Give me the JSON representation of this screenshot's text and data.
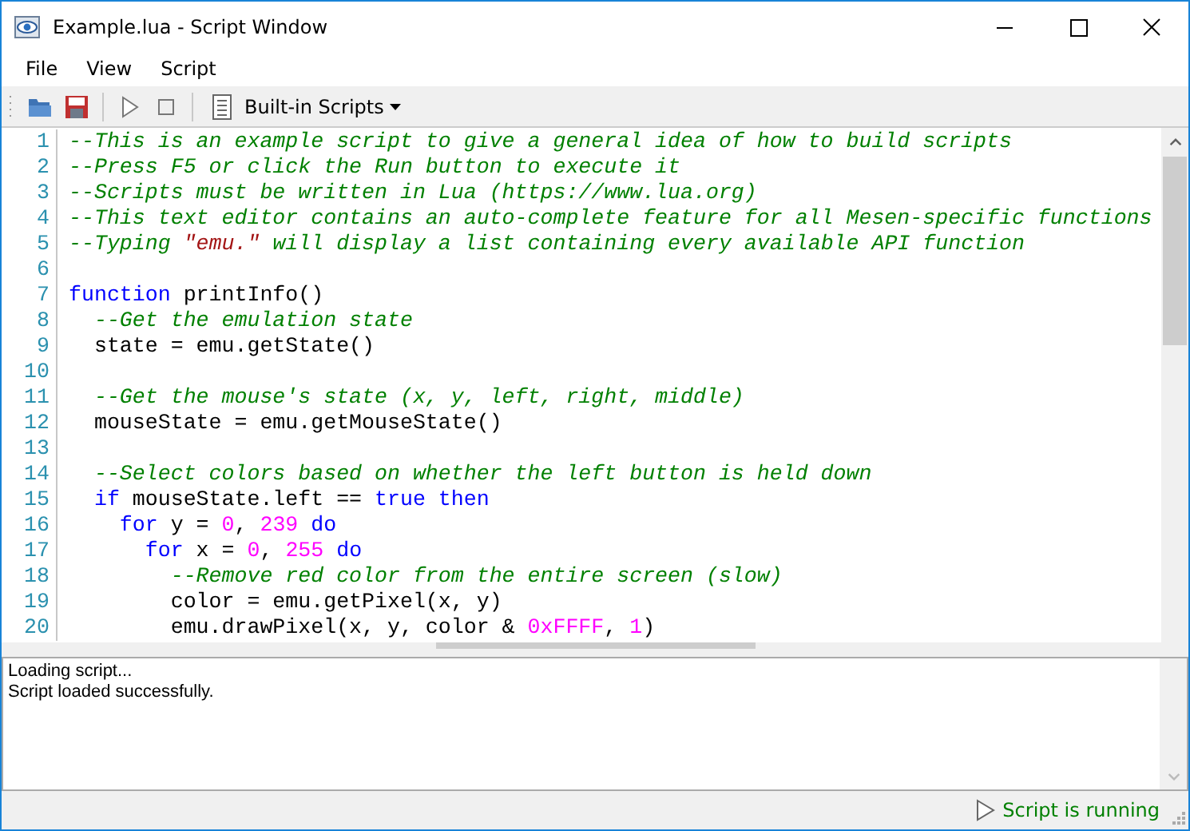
{
  "window": {
    "title": "Example.lua - Script Window"
  },
  "menu": [
    "File",
    "View",
    "Script"
  ],
  "toolbar": {
    "dropdown": "Built-in Scripts"
  },
  "editor": {
    "lines": [
      {
        "number": "1",
        "tokens": [
          {
            "kind": "comment",
            "text": "--This is an example script to give a general idea of how to build scripts"
          }
        ]
      },
      {
        "number": "2",
        "tokens": [
          {
            "kind": "comment",
            "text": "--Press F5 or click the Run button to execute it"
          }
        ]
      },
      {
        "number": "3",
        "tokens": [
          {
            "kind": "comment",
            "text": "--Scripts must be written in Lua (https://www.lua.org)"
          }
        ]
      },
      {
        "number": "4",
        "tokens": [
          {
            "kind": "comment",
            "text": "--This text editor contains an auto-complete feature for all Mesen-specific functions"
          }
        ]
      },
      {
        "number": "5",
        "tokens": [
          {
            "kind": "comment",
            "text": "--Typing "
          },
          {
            "kind": "string",
            "text": "\"emu.\""
          },
          {
            "kind": "comment",
            "text": " will display a list containing every available API function"
          }
        ]
      },
      {
        "number": "6"
      },
      {
        "number": "7",
        "tokens": [
          {
            "kind": "keyword",
            "text": "function"
          },
          {
            "kind": "plain",
            "text": " printInfo()"
          }
        ]
      },
      {
        "number": "8",
        "tokens": [
          {
            "kind": "comment",
            "text": "  --Get the emulation state"
          }
        ]
      },
      {
        "number": "9",
        "tokens": [
          {
            "kind": "plain",
            "text": "  state = emu.getState()"
          }
        ]
      },
      {
        "number": "10"
      },
      {
        "number": "11",
        "tokens": [
          {
            "kind": "comment",
            "text": "  --Get the mouse's state (x, y, left, right, middle)"
          }
        ]
      },
      {
        "number": "12",
        "tokens": [
          {
            "kind": "plain",
            "text": "  mouseState = emu.getMouseState()"
          }
        ]
      },
      {
        "number": "13"
      },
      {
        "number": "14",
        "tokens": [
          {
            "kind": "comment",
            "text": "  --Select colors based on whether the left button is held down"
          }
        ]
      },
      {
        "number": "15",
        "tokens": [
          {
            "kind": "keyword",
            "text": "  if"
          },
          {
            "kind": "plain",
            "text": " mouseState.left == "
          },
          {
            "kind": "keyword",
            "text": "true then"
          }
        ]
      },
      {
        "number": "16",
        "tokens": [
          {
            "kind": "keyword",
            "text": "    for"
          },
          {
            "kind": "plain",
            "text": " y = "
          },
          {
            "kind": "number",
            "text": "0"
          },
          {
            "kind": "plain",
            "text": ", "
          },
          {
            "kind": "number",
            "text": "239"
          },
          {
            "kind": "keyword",
            "text": " do"
          }
        ]
      },
      {
        "number": "17",
        "tokens": [
          {
            "kind": "keyword",
            "text": "      for"
          },
          {
            "kind": "plain",
            "text": " x = "
          },
          {
            "kind": "number",
            "text": "0"
          },
          {
            "kind": "plain",
            "text": ", "
          },
          {
            "kind": "number",
            "text": "255"
          },
          {
            "kind": "keyword",
            "text": " do"
          }
        ]
      },
      {
        "number": "18",
        "tokens": [
          {
            "kind": "comment",
            "text": "        --Remove red color from the entire screen (slow)"
          }
        ]
      },
      {
        "number": "19",
        "tokens": [
          {
            "kind": "plain",
            "text": "        color = emu.getPixel(x, y)"
          }
        ]
      },
      {
        "number": "20",
        "tokens": [
          {
            "kind": "plain",
            "text": "        emu.drawPixel(x, y, color & "
          },
          {
            "kind": "number",
            "text": "0xFFFF"
          },
          {
            "kind": "plain",
            "text": ", "
          },
          {
            "kind": "number",
            "text": "1"
          },
          {
            "kind": "plain",
            "text": ")"
          }
        ]
      }
    ]
  },
  "log": [
    "Loading script...",
    "Script loaded successfully."
  ],
  "status_bar": {
    "text": "Script is running"
  }
}
